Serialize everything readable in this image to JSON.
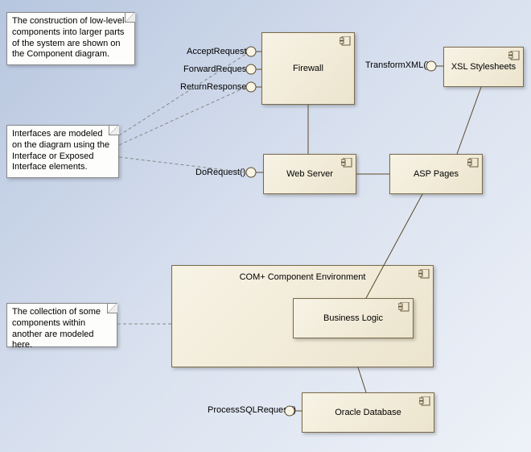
{
  "notes": {
    "n1": "The construction of low-level components into larger parts of the system are shown on the Component diagram.",
    "n2": "Interfaces are modeled on the diagram using the Interface or Exposed Interface elements.",
    "n3": "The collection of some components within another are modeled here."
  },
  "components": {
    "firewall": "Firewall",
    "webserver": "Web Server",
    "xsl": "XSL Stylesheets",
    "asp": "ASP Pages",
    "com": "COM+ Component Environment",
    "biz": "Business Logic",
    "oracle": "Oracle Database"
  },
  "interfaces": {
    "acceptReq": "AcceptRequest()",
    "forwardReq": "ForwardRequest()",
    "returnResp": "ReturnResponse()",
    "doReq": "DoRequest()",
    "transformXML": "TransformXML()",
    "processSQL": "ProcessSQLRequest()"
  }
}
